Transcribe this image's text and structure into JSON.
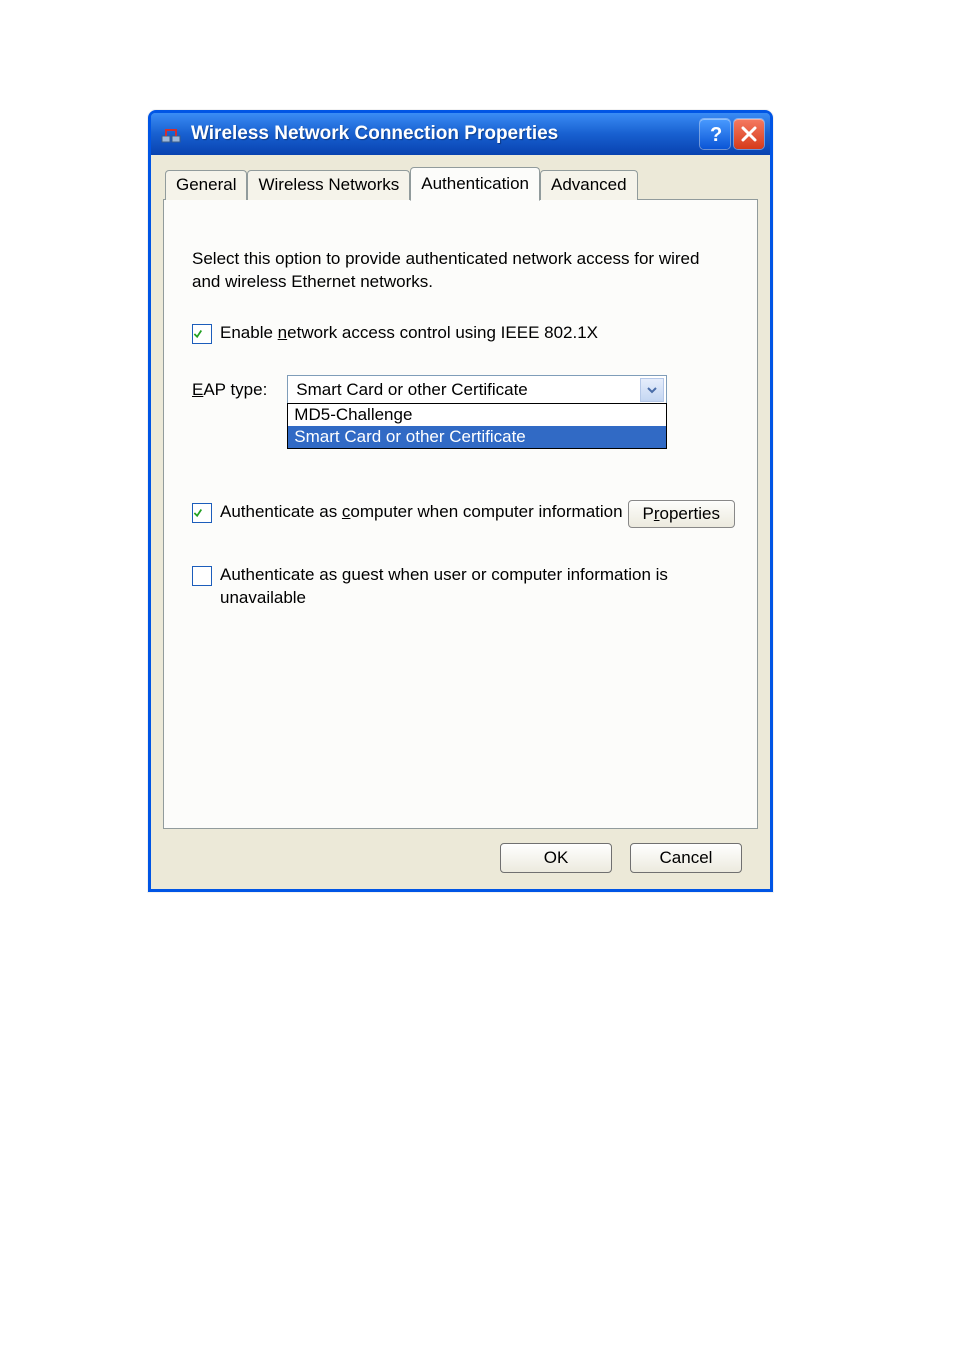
{
  "titlebar": {
    "title": "Wireless Network Connection Properties"
  },
  "tabs": {
    "general": "General",
    "wireless_networks": "Wireless Networks",
    "authentication": "Authentication",
    "advanced": "Advanced"
  },
  "content": {
    "description": "Select this option to provide authenticated network access for wired and wireless Ethernet networks.",
    "enable_check_pre": "Enable ",
    "enable_check_m": "n",
    "enable_check_post": "etwork access control using IEEE 802.1X",
    "eap_label_m": "E",
    "eap_label_rest": "AP type:",
    "eap_selected": "Smart Card or other Certificate",
    "eap_options": {
      "0": "MD5-Challenge",
      "1": "Smart Card or other Certificate"
    },
    "properties_pre": "P",
    "properties_m": "r",
    "properties_post": "operties",
    "auth_computer_pre": "Authenticate as ",
    "auth_computer_m": "c",
    "auth_computer_post": "omputer when computer information is available",
    "auth_guest_pre": "Authenticate as ",
    "auth_guest_m": "g",
    "auth_guest_post": "uest when user or computer information is unavailable"
  },
  "buttons": {
    "ok": "OK",
    "cancel": "Cancel"
  }
}
